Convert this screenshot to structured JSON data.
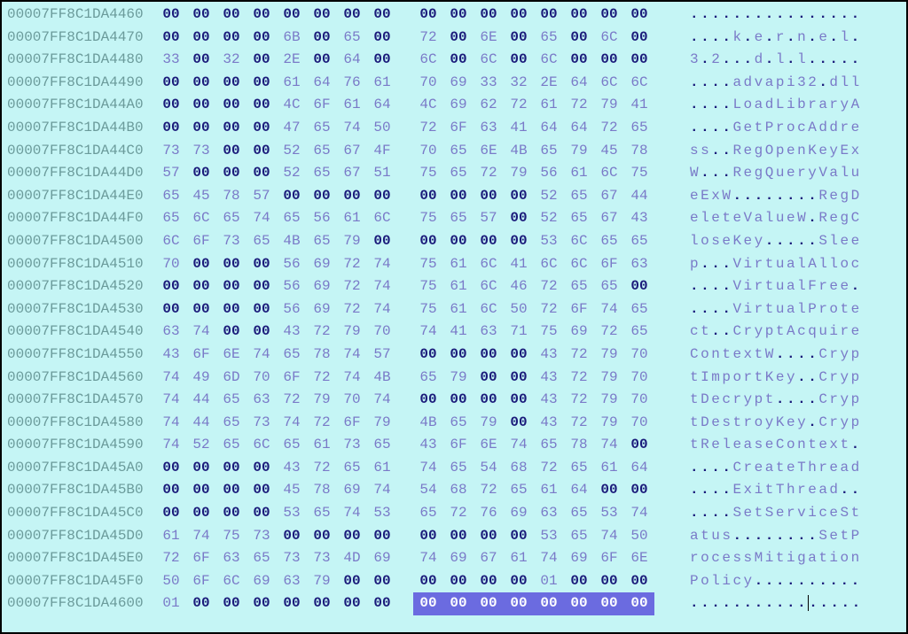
{
  "rows": [
    {
      "addr": "00007FF8C1DA4460",
      "hex": [
        "00",
        "00",
        "00",
        "00",
        "00",
        "00",
        "00",
        "00",
        "00",
        "00",
        "00",
        "00",
        "00",
        "00",
        "00",
        "00"
      ],
      "ascii": "................"
    },
    {
      "addr": "00007FF8C1DA4470",
      "hex": [
        "00",
        "00",
        "00",
        "00",
        "6B",
        "00",
        "65",
        "00",
        "72",
        "00",
        "6E",
        "00",
        "65",
        "00",
        "6C",
        "00"
      ],
      "ascii": "....k.e.r.n.e.l."
    },
    {
      "addr": "00007FF8C1DA4480",
      "hex": [
        "33",
        "00",
        "32",
        "00",
        "2E",
        "00",
        "64",
        "00",
        "6C",
        "00",
        "6C",
        "00",
        "6C",
        "00",
        "00",
        "00"
      ],
      "ascii": "3.2...d.l.l....."
    },
    {
      "addr": "00007FF8C1DA4490",
      "hex": [
        "00",
        "00",
        "00",
        "00",
        "61",
        "64",
        "76",
        "61",
        "70",
        "69",
        "33",
        "32",
        "2E",
        "64",
        "6C",
        "6C"
      ],
      "ascii": "....advapi32.dll"
    },
    {
      "addr": "00007FF8C1DA44A0",
      "hex": [
        "00",
        "00",
        "00",
        "00",
        "4C",
        "6F",
        "61",
        "64",
        "4C",
        "69",
        "62",
        "72",
        "61",
        "72",
        "79",
        "41"
      ],
      "ascii": "....LoadLibraryA"
    },
    {
      "addr": "00007FF8C1DA44B0",
      "hex": [
        "00",
        "00",
        "00",
        "00",
        "47",
        "65",
        "74",
        "50",
        "72",
        "6F",
        "63",
        "41",
        "64",
        "64",
        "72",
        "65"
      ],
      "ascii": "....GetProcAddre"
    },
    {
      "addr": "00007FF8C1DA44C0",
      "hex": [
        "73",
        "73",
        "00",
        "00",
        "52",
        "65",
        "67",
        "4F",
        "70",
        "65",
        "6E",
        "4B",
        "65",
        "79",
        "45",
        "78"
      ],
      "ascii": "ss..RegOpenKeyEx"
    },
    {
      "addr": "00007FF8C1DA44D0",
      "hex": [
        "57",
        "00",
        "00",
        "00",
        "52",
        "65",
        "67",
        "51",
        "75",
        "65",
        "72",
        "79",
        "56",
        "61",
        "6C",
        "75"
      ],
      "ascii": "W...RegQueryValu"
    },
    {
      "addr": "00007FF8C1DA44E0",
      "hex": [
        "65",
        "45",
        "78",
        "57",
        "00",
        "00",
        "00",
        "00",
        "00",
        "00",
        "00",
        "00",
        "52",
        "65",
        "67",
        "44"
      ],
      "ascii": "eExW........RegD"
    },
    {
      "addr": "00007FF8C1DA44F0",
      "hex": [
        "65",
        "6C",
        "65",
        "74",
        "65",
        "56",
        "61",
        "6C",
        "75",
        "65",
        "57",
        "00",
        "52",
        "65",
        "67",
        "43"
      ],
      "ascii": "eleteValueW.RegC"
    },
    {
      "addr": "00007FF8C1DA4500",
      "hex": [
        "6C",
        "6F",
        "73",
        "65",
        "4B",
        "65",
        "79",
        "00",
        "00",
        "00",
        "00",
        "00",
        "53",
        "6C",
        "65",
        "65"
      ],
      "ascii": "loseKey.....Slee"
    },
    {
      "addr": "00007FF8C1DA4510",
      "hex": [
        "70",
        "00",
        "00",
        "00",
        "56",
        "69",
        "72",
        "74",
        "75",
        "61",
        "6C",
        "41",
        "6C",
        "6C",
        "6F",
        "63"
      ],
      "ascii": "p...VirtualAlloc"
    },
    {
      "addr": "00007FF8C1DA4520",
      "hex": [
        "00",
        "00",
        "00",
        "00",
        "56",
        "69",
        "72",
        "74",
        "75",
        "61",
        "6C",
        "46",
        "72",
        "65",
        "65",
        "00"
      ],
      "ascii": "....VirtualFree."
    },
    {
      "addr": "00007FF8C1DA4530",
      "hex": [
        "00",
        "00",
        "00",
        "00",
        "56",
        "69",
        "72",
        "74",
        "75",
        "61",
        "6C",
        "50",
        "72",
        "6F",
        "74",
        "65"
      ],
      "ascii": "....VirtualProte"
    },
    {
      "addr": "00007FF8C1DA4540",
      "hex": [
        "63",
        "74",
        "00",
        "00",
        "43",
        "72",
        "79",
        "70",
        "74",
        "41",
        "63",
        "71",
        "75",
        "69",
        "72",
        "65"
      ],
      "ascii": "ct..CryptAcquire"
    },
    {
      "addr": "00007FF8C1DA4550",
      "hex": [
        "43",
        "6F",
        "6E",
        "74",
        "65",
        "78",
        "74",
        "57",
        "00",
        "00",
        "00",
        "00",
        "43",
        "72",
        "79",
        "70"
      ],
      "ascii": "ContextW....Cryp"
    },
    {
      "addr": "00007FF8C1DA4560",
      "hex": [
        "74",
        "49",
        "6D",
        "70",
        "6F",
        "72",
        "74",
        "4B",
        "65",
        "79",
        "00",
        "00",
        "43",
        "72",
        "79",
        "70"
      ],
      "ascii": "tImportKey..Cryp"
    },
    {
      "addr": "00007FF8C1DA4570",
      "hex": [
        "74",
        "44",
        "65",
        "63",
        "72",
        "79",
        "70",
        "74",
        "00",
        "00",
        "00",
        "00",
        "43",
        "72",
        "79",
        "70"
      ],
      "ascii": "tDecrypt....Cryp"
    },
    {
      "addr": "00007FF8C1DA4580",
      "hex": [
        "74",
        "44",
        "65",
        "73",
        "74",
        "72",
        "6F",
        "79",
        "4B",
        "65",
        "79",
        "00",
        "43",
        "72",
        "79",
        "70"
      ],
      "ascii": "tDestroyKey.Cryp"
    },
    {
      "addr": "00007FF8C1DA4590",
      "hex": [
        "74",
        "52",
        "65",
        "6C",
        "65",
        "61",
        "73",
        "65",
        "43",
        "6F",
        "6E",
        "74",
        "65",
        "78",
        "74",
        "00"
      ],
      "ascii": "tReleaseContext."
    },
    {
      "addr": "00007FF8C1DA45A0",
      "hex": [
        "00",
        "00",
        "00",
        "00",
        "43",
        "72",
        "65",
        "61",
        "74",
        "65",
        "54",
        "68",
        "72",
        "65",
        "61",
        "64"
      ],
      "ascii": "....CreateThread"
    },
    {
      "addr": "00007FF8C1DA45B0",
      "hex": [
        "00",
        "00",
        "00",
        "00",
        "45",
        "78",
        "69",
        "74",
        "54",
        "68",
        "72",
        "65",
        "61",
        "64",
        "00",
        "00"
      ],
      "ascii": "....ExitThread.."
    },
    {
      "addr": "00007FF8C1DA45C0",
      "hex": [
        "00",
        "00",
        "00",
        "00",
        "53",
        "65",
        "74",
        "53",
        "65",
        "72",
        "76",
        "69",
        "63",
        "65",
        "53",
        "74"
      ],
      "ascii": "....SetServiceSt"
    },
    {
      "addr": "00007FF8C1DA45D0",
      "hex": [
        "61",
        "74",
        "75",
        "73",
        "00",
        "00",
        "00",
        "00",
        "00",
        "00",
        "00",
        "00",
        "53",
        "65",
        "74",
        "50"
      ],
      "ascii": "atus........SetP"
    },
    {
      "addr": "00007FF8C1DA45E0",
      "hex": [
        "72",
        "6F",
        "63",
        "65",
        "73",
        "73",
        "4D",
        "69",
        "74",
        "69",
        "67",
        "61",
        "74",
        "69",
        "6F",
        "6E"
      ],
      "ascii": "rocessMitigation"
    },
    {
      "addr": "00007FF8C1DA45F0",
      "hex": [
        "50",
        "6F",
        "6C",
        "69",
        "63",
        "79",
        "00",
        "00",
        "00",
        "00",
        "00",
        "00",
        "01",
        "00",
        "00",
        "00"
      ],
      "ascii": "Policy.........."
    },
    {
      "addr": "00007FF8C1DA4600",
      "hex": [
        "01",
        "00",
        "00",
        "00",
        "00",
        "00",
        "00",
        "00",
        "00",
        "00",
        "00",
        "00",
        "00",
        "00",
        "00",
        "00"
      ],
      "ascii": "................",
      "selStart": 8,
      "caretAscii": 11
    }
  ]
}
